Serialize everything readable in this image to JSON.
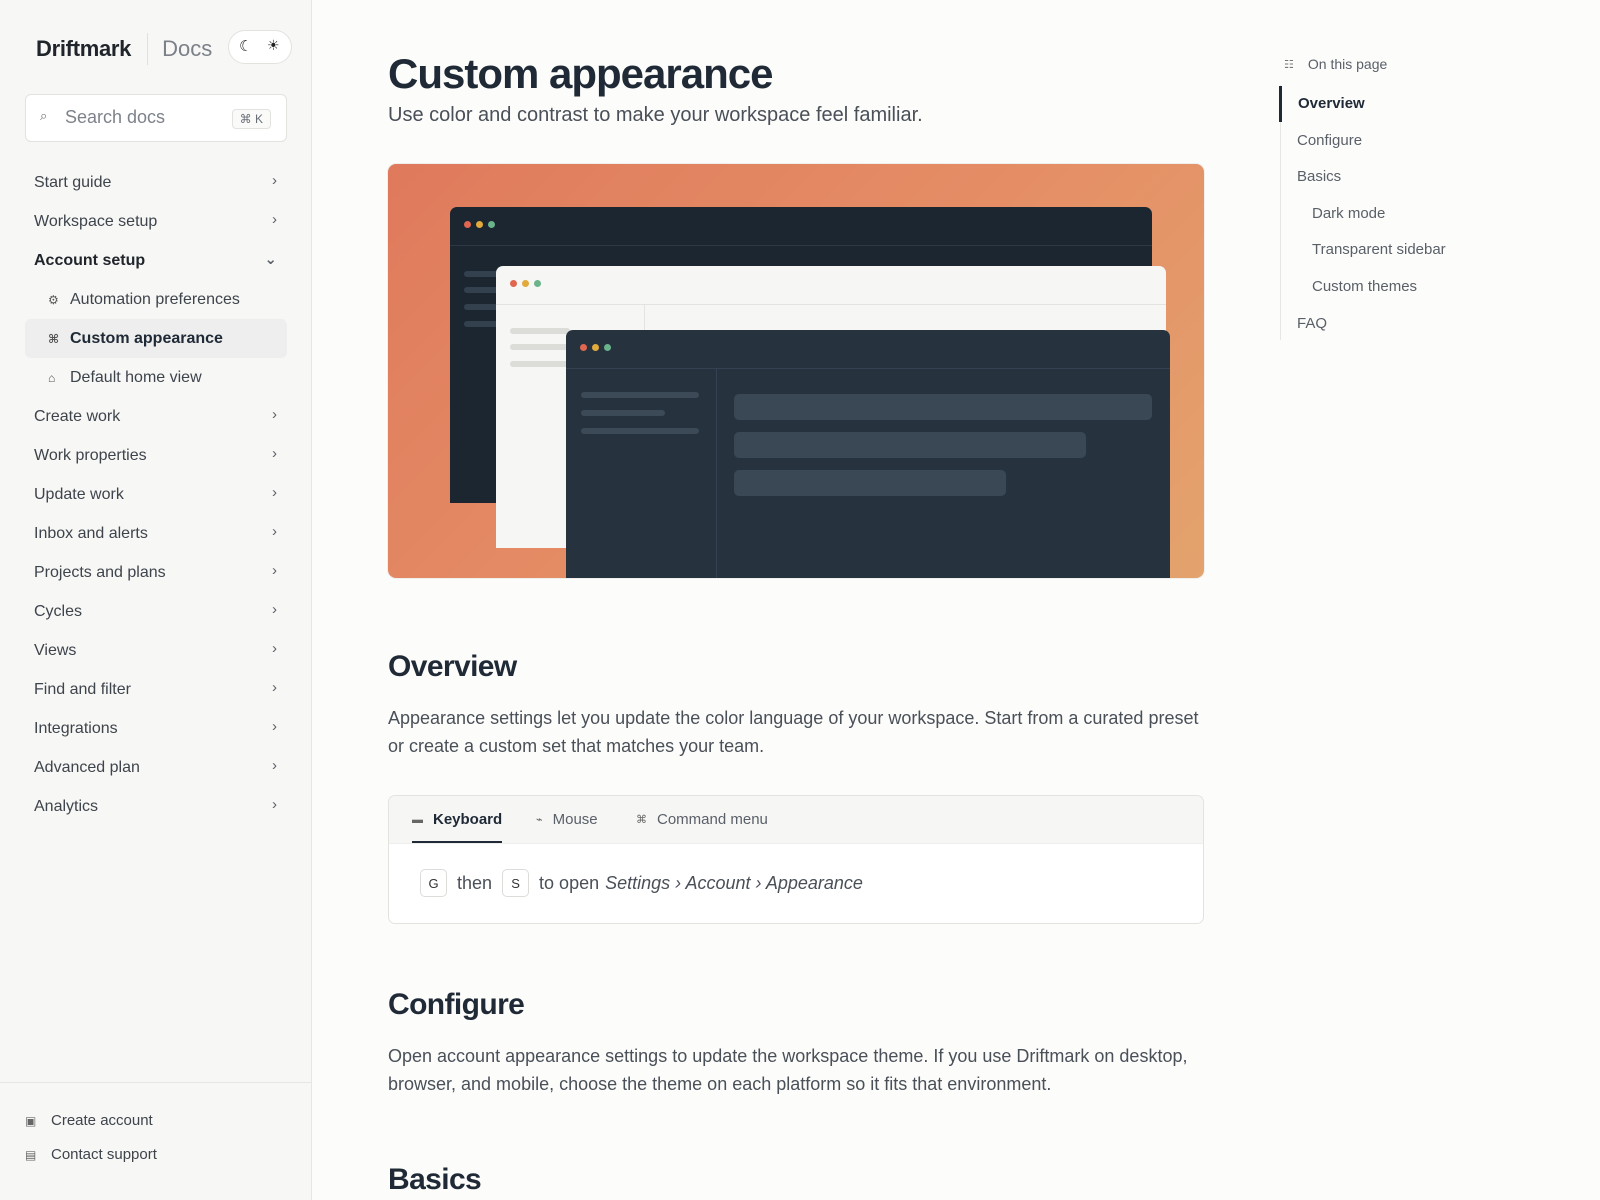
{
  "brand": {
    "name": "Driftmark",
    "section": "Docs"
  },
  "search": {
    "placeholder": "Search docs",
    "shortcut": "⌘ K"
  },
  "nav": {
    "items_top": [
      {
        "label": "Start guide"
      },
      {
        "label": "Workspace setup"
      }
    ],
    "open_section": {
      "label": "Account setup",
      "children": [
        {
          "label": "Automation preferences",
          "icon": "gear-icon"
        },
        {
          "label": "Custom appearance",
          "icon": "command-icon",
          "active": true
        },
        {
          "label": "Default home view",
          "icon": "home-icon"
        }
      ]
    },
    "items_bottom": [
      {
        "label": "Create work"
      },
      {
        "label": "Work properties"
      },
      {
        "label": "Update work"
      },
      {
        "label": "Inbox and alerts"
      },
      {
        "label": "Projects and plans"
      },
      {
        "label": "Cycles"
      },
      {
        "label": "Views"
      },
      {
        "label": "Find and filter"
      },
      {
        "label": "Integrations"
      },
      {
        "label": "Advanced plan"
      },
      {
        "label": "Analytics"
      }
    ]
  },
  "footer": {
    "create_account": "Create account",
    "contact_support": "Contact support"
  },
  "page": {
    "title": "Custom appearance",
    "subtitle": "Use color and contrast to make your workspace feel familiar.",
    "overview": {
      "heading": "Overview",
      "text": "Appearance settings let you update the color language of your workspace. Start from a curated preset or create a custom set that matches your team."
    },
    "tabs": [
      {
        "label": "Keyboard",
        "icon": "keyboard-icon",
        "active": true
      },
      {
        "label": "Mouse",
        "icon": "mouse-icon"
      },
      {
        "label": "Command menu",
        "icon": "command-icon"
      }
    ],
    "shortcut": {
      "key1": "G",
      "then": "then",
      "key2": "S",
      "action": "to open",
      "path": "Settings › Account › Appearance"
    },
    "configure": {
      "heading": "Configure",
      "text": "Open account appearance settings to update the workspace theme. If you use Driftmark on desktop, browser, and mobile, choose the theme on each platform so it fits that environment."
    },
    "basics": {
      "heading": "Basics"
    }
  },
  "toc": {
    "title": "On this page",
    "items": [
      {
        "label": "Overview",
        "active": true
      },
      {
        "label": "Configure"
      },
      {
        "label": "Basics"
      },
      {
        "label": "Dark mode",
        "nested": true
      },
      {
        "label": "Transparent sidebar",
        "nested": true
      },
      {
        "label": "Custom themes",
        "nested": true
      },
      {
        "label": "FAQ"
      }
    ]
  },
  "colors": {
    "accent": "#1f2a36",
    "hero_gradient_start": "#df7a5c",
    "hero_gradient_end": "#e3a36d",
    "dot_red": "#e0664f",
    "dot_yellow": "#e2a93b",
    "dot_green": "#6bb38a"
  }
}
